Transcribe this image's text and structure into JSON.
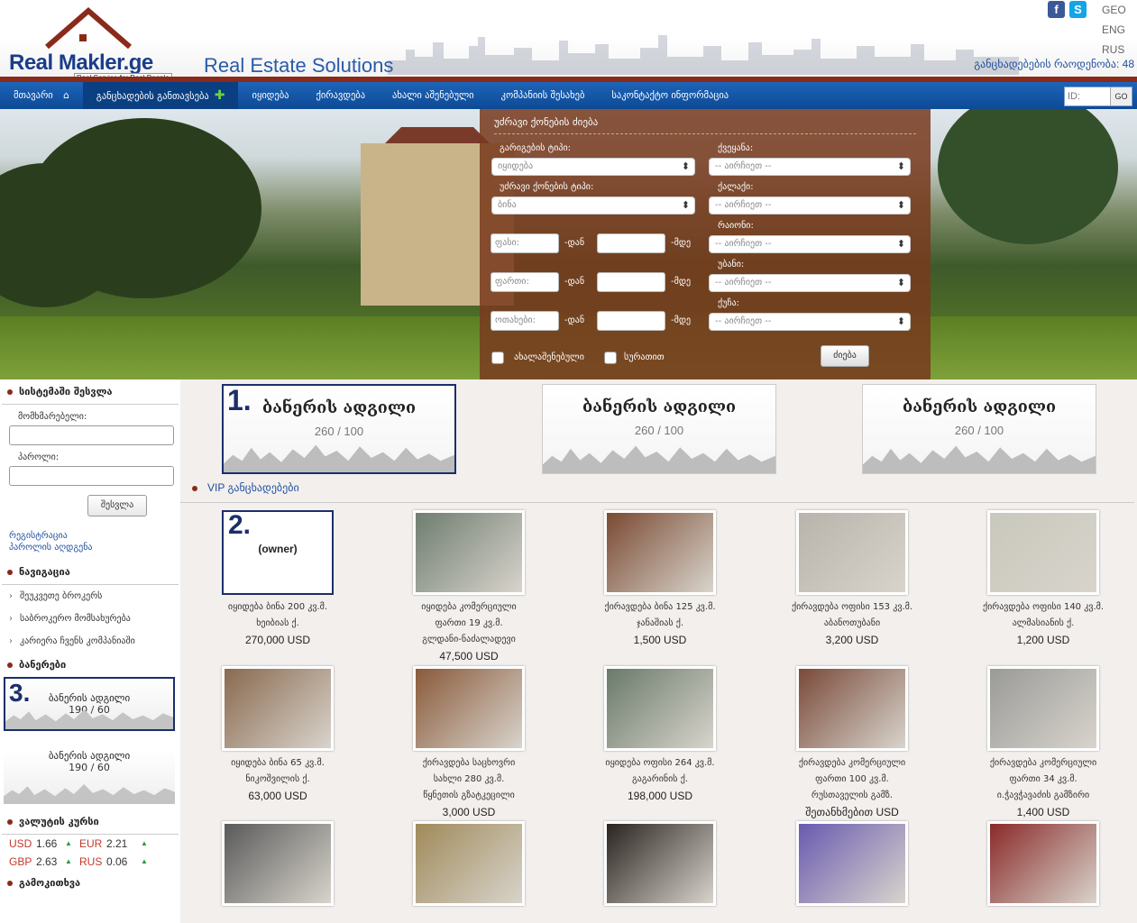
{
  "header": {
    "logo_name": "Real Makler.ge",
    "logo_tagline": "Real Service for Real People",
    "slogan": "Real Estate Solutions",
    "languages": [
      "GEO",
      "ENG",
      "RUS"
    ],
    "counter_label": "განცხადებების რაოდენობა: 48"
  },
  "nav": {
    "items": [
      "მთავარი",
      "განცხადების განთავსება",
      "იყიდება",
      "ქირავდება",
      "ახალი აშენებული",
      "კომპანიის შესახებ",
      "საკონტაქტო ინფორმაცია"
    ],
    "id_placeholder": "ID:",
    "go_label": "GO"
  },
  "search": {
    "title": "უძრავი ქონების ძიება",
    "deal_type_label": "გარიგების ტიპი:",
    "deal_type_value": "იყიდება",
    "property_type_label": "უძრავი ქონების ტიპი:",
    "property_type_value": "ბინა",
    "country_label": "ქვეყანა:",
    "city_label": "ქალაქი:",
    "district_label": "რაიონი:",
    "subdistrict_label": "უბანი:",
    "street_label": "ქუჩა:",
    "choose": "-- აირჩიეთ --",
    "price_placeholder": "ფასი:",
    "area_placeholder": "ფართი:",
    "rooms_placeholder": "ოთახები:",
    "from": "-დან",
    "to": "-მდე",
    "new_built": "ახალაშენებული",
    "with_photo": "სურათით",
    "submit": "ძიება"
  },
  "sidebar": {
    "login_title": "სისტემაში შესვლა",
    "username_label": "მომხმარებელი:",
    "password_label": "პაროლი:",
    "login_button": "შესვლა",
    "register": "რეგისტრაცია",
    "restore_password": "პაროლის აღდგენა",
    "nav_title": "ნავიგაცია",
    "nav_links": [
      "შეუკვეთე ბროკერს",
      "საბროკერო მომსახურება",
      "კარიერა ჩვენს კომპანიაში"
    ],
    "banners_title": "ბანერები",
    "banners": [
      {
        "num": "3.",
        "title": "ბანერის ადგილი",
        "size": "190 / 60"
      },
      {
        "num": "",
        "title": "ბანერის ადგილი",
        "size": "190 / 60"
      }
    ],
    "rates_title": "ვალუტის კურსი",
    "rates": [
      {
        "c1": "USD",
        "v1": "1.66",
        "c2": "EUR",
        "v2": "2.21"
      },
      {
        "c1": "GBP",
        "v1": "2.63",
        "c2": "RUS",
        "v2": "0.06"
      }
    ],
    "poll_title": "გამოკითხვა"
  },
  "banners": [
    {
      "num": "1.",
      "title": "ბანერის ადგილი",
      "size": "260 / 100"
    },
    {
      "num": "",
      "title": "ბანერის ადგილი",
      "size": "260 / 100"
    },
    {
      "num": "",
      "title": "ბანერის ადგილი",
      "size": "260 / 100"
    }
  ],
  "vip_title": "VIP განცხადებები",
  "listings": [
    {
      "l1": "იყიდება ბინა 200 კვ.მ.",
      "l2": "ხეიბიას ქ.",
      "l3": "",
      "price": "270,000 USD",
      "owner_num": "2.",
      "owner_text": "(owner)",
      "color": "#ffffff"
    },
    {
      "l1": "იყიდება კომერციული",
      "l2": "ფართი 19 კვ.მ.",
      "l3": "გლდანი-ნაძალადევი",
      "price": "47,500 USD",
      "color": "#6f7d70"
    },
    {
      "l1": "ქირავდება ბინა 125 კვ.მ.",
      "l2": "ჯანაშიას ქ.",
      "l3": "",
      "price": "1,500 USD",
      "color": "#7a4a32"
    },
    {
      "l1": "ქირავდება ოფისი 153 კვ.მ.",
      "l2": "აბანოთუბანი",
      "l3": "",
      "price": "3,200 USD",
      "color": "#b8b4ac"
    },
    {
      "l1": "ქირავდება ოფისი 140 კვ.მ.",
      "l2": "ალმასიანის ქ.",
      "l3": "",
      "price": "1,200 USD",
      "color": "#c9c8bc"
    },
    {
      "l1": "იყიდება ბინა 65 კვ.მ.",
      "l2": "ნიკოშვილის ქ.",
      "l3": "",
      "price": "63,000 USD",
      "color": "#8a6a50"
    },
    {
      "l1": "ქირავდება საცხოვრი",
      "l2": "სახლი 280 კვ.მ.",
      "l3": "წყნეთის გზატკეცილი",
      "price": "3,000 USD",
      "color": "#8a5a3a"
    },
    {
      "l1": "იყიდება ოფისი 264 კვ.მ.",
      "l2": "გაგარინის ქ.",
      "l3": "",
      "price": "198,000 USD",
      "color": "#6a7a6a"
    },
    {
      "l1": "ქირავდება კომერციული",
      "l2": "ფართი 100 კვ.მ.",
      "l3": "რუსთაველის გამზ.",
      "price": "შეთანხმებით USD",
      "color": "#7a4a3a"
    },
    {
      "l1": "ქირავდება კომერციული",
      "l2": "ფართი 34 კვ.მ.",
      "l3": "ი.ჭავჭავაძის გამზირი",
      "price": "1,400 USD",
      "color": "#9a9a98"
    },
    {
      "l1": "",
      "l2": "",
      "l3": "",
      "price": "",
      "color": "#5a5a5a"
    },
    {
      "l1": "",
      "l2": "",
      "l3": "",
      "price": "",
      "color": "#a08a5a"
    },
    {
      "l1": "",
      "l2": "",
      "l3": "",
      "price": "",
      "color": "#2a2420"
    },
    {
      "l1": "",
      "l2": "",
      "l3": "",
      "price": "",
      "color": "#6a5ab0"
    },
    {
      "l1": "",
      "l2": "",
      "l3": "",
      "price": "",
      "color": "#8a2a2a"
    }
  ]
}
